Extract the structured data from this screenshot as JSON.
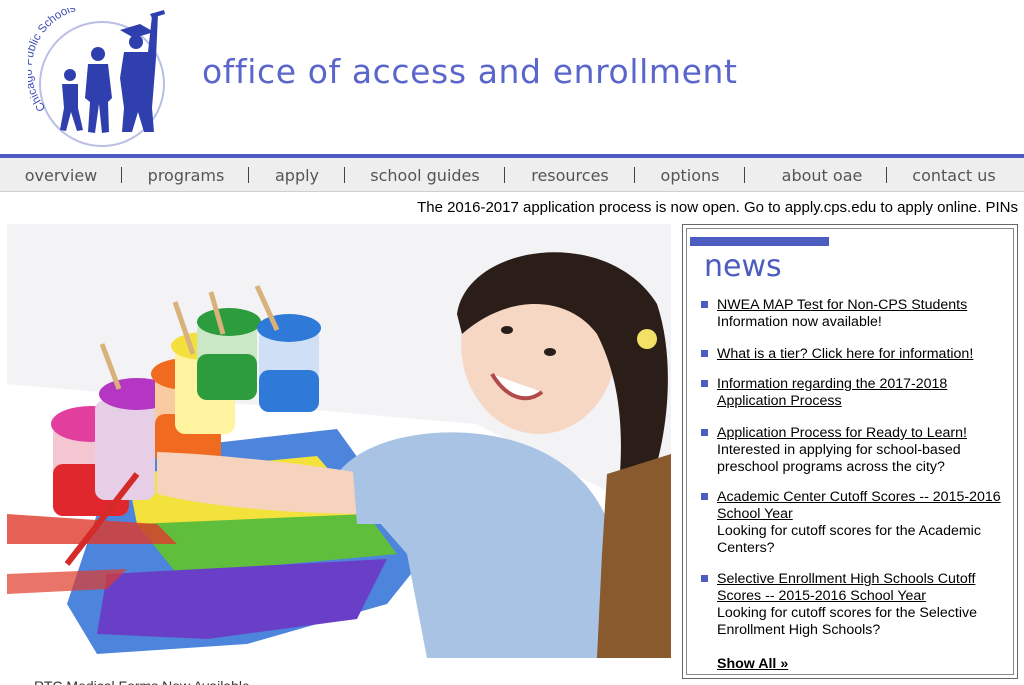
{
  "header": {
    "logo_text": "Chicago Public Schools",
    "title": "office of access and enrollment"
  },
  "nav": {
    "items": [
      {
        "label": "overview"
      },
      {
        "label": "programs"
      },
      {
        "label": "apply"
      },
      {
        "label": "school guides"
      },
      {
        "label": "resources"
      },
      {
        "label": "options"
      },
      {
        "label": "about oae"
      },
      {
        "label": "contact us"
      }
    ]
  },
  "ticker": {
    "text": "The 2016-2017 application process is now open. Go to apply.cps.edu to apply online. PINs"
  },
  "news": {
    "title": "news",
    "items": [
      {
        "link": "NWEA MAP Test for Non-CPS Students",
        "desc": "Information now available!"
      },
      {
        "link": "What is a tier? Click here for information!",
        "desc": ""
      },
      {
        "link": "Information regarding the 2017-2018 Application Process",
        "desc": ""
      },
      {
        "link": "Application Process for Ready to Learn!",
        "desc": "Interested in applying for school-based preschool programs across the city?"
      },
      {
        "link": "Academic Center Cutoff Scores -- 2015-2016 School Year",
        "desc": "Looking for cutoff scores for the Academic Centers?"
      },
      {
        "link": "Selective Enrollment High Schools Cutoff Scores -- 2015-2016 School Year",
        "desc": "Looking for cutoff scores for the Selective Enrollment High Schools?"
      }
    ],
    "show_all": "Show All »"
  },
  "bottom": {
    "text": "RTC Medical Forms Now Available"
  },
  "colors": {
    "brand_blue": "#4c5cc0",
    "title_blue": "#5a66cc",
    "nav_bg": "#eeeeee"
  }
}
